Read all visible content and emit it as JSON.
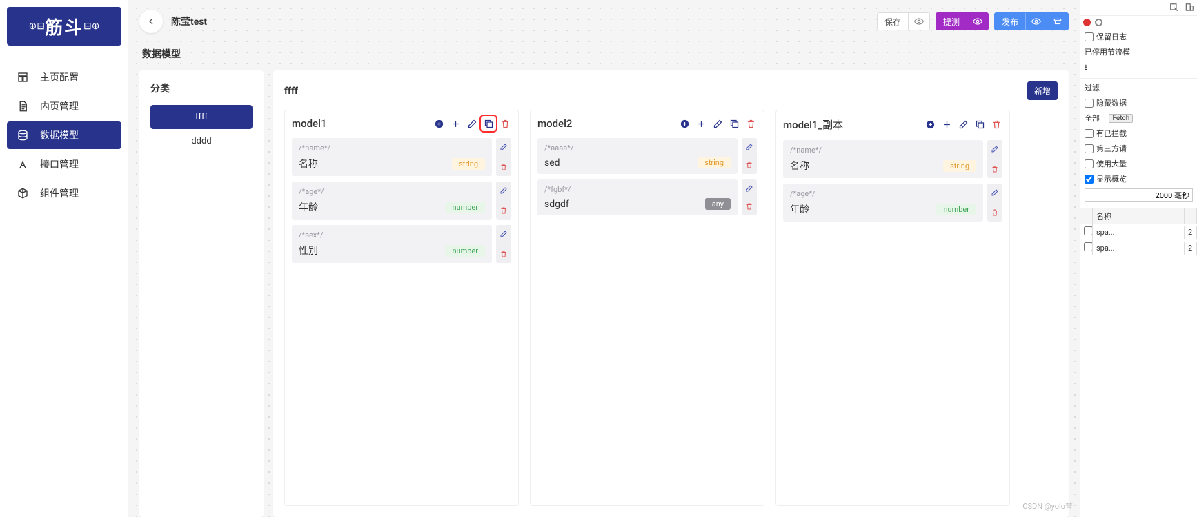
{
  "logo": {
    "text": "筋斗",
    "dec_left": "⊕⊟",
    "dec_right": "⊟⊕"
  },
  "nav": [
    {
      "id": "home",
      "label": "主页配置",
      "active": false
    },
    {
      "id": "pages",
      "label": "内页管理",
      "active": false
    },
    {
      "id": "data",
      "label": "数据模型",
      "active": true
    },
    {
      "id": "api",
      "label": "接口管理",
      "active": false
    },
    {
      "id": "comp",
      "label": "组件管理",
      "active": false
    }
  ],
  "header": {
    "back_aria": "返回",
    "title": "陈莹test"
  },
  "actions": {
    "save": "保存",
    "submit": "提测",
    "publish": "发布"
  },
  "section_title": "数据模型",
  "category": {
    "title": "分类",
    "items": [
      {
        "label": "ffff",
        "active": true
      },
      {
        "label": "dddd",
        "active": false
      }
    ]
  },
  "models_head": {
    "title": "ffff",
    "add": "新增"
  },
  "models": [
    {
      "name": "model1",
      "copy_highlight": true,
      "fields": [
        {
          "comment": "/*name*/",
          "label": "名称",
          "type": "string"
        },
        {
          "comment": "/*age*/",
          "label": "年龄",
          "type": "number"
        },
        {
          "comment": "/*sex*/",
          "label": "性别",
          "type": "number"
        }
      ]
    },
    {
      "name": "model2",
      "copy_highlight": false,
      "fields": [
        {
          "comment": "/*aaaa*/",
          "label": "sed",
          "type": "string"
        },
        {
          "comment": "/*fgbf*/",
          "label": "sdgdf",
          "type": "any"
        }
      ]
    },
    {
      "name": "model1_副本",
      "copy_highlight": false,
      "fields": [
        {
          "comment": "/*name*/",
          "label": "名称",
          "type": "string"
        },
        {
          "comment": "/*age*/",
          "label": "年龄",
          "type": "number"
        }
      ]
    }
  ],
  "devtools": {
    "keep_log": "保留日志",
    "throttle_status": "已停用节流模",
    "filter": "过滤",
    "hide_data": "隐藏数据",
    "all": "全部",
    "fetch": "Fetch",
    "blocked": "有已拦截",
    "third": "第三方请",
    "large": "使用大量",
    "preview": "显示概览",
    "ms_value": "2000 毫秒",
    "col_name": "名称",
    "rows": [
      {
        "n": "spa...",
        "v": "2"
      },
      {
        "n": "spa...",
        "v": "2"
      }
    ]
  },
  "watermark": "CSDN @yolo莹"
}
